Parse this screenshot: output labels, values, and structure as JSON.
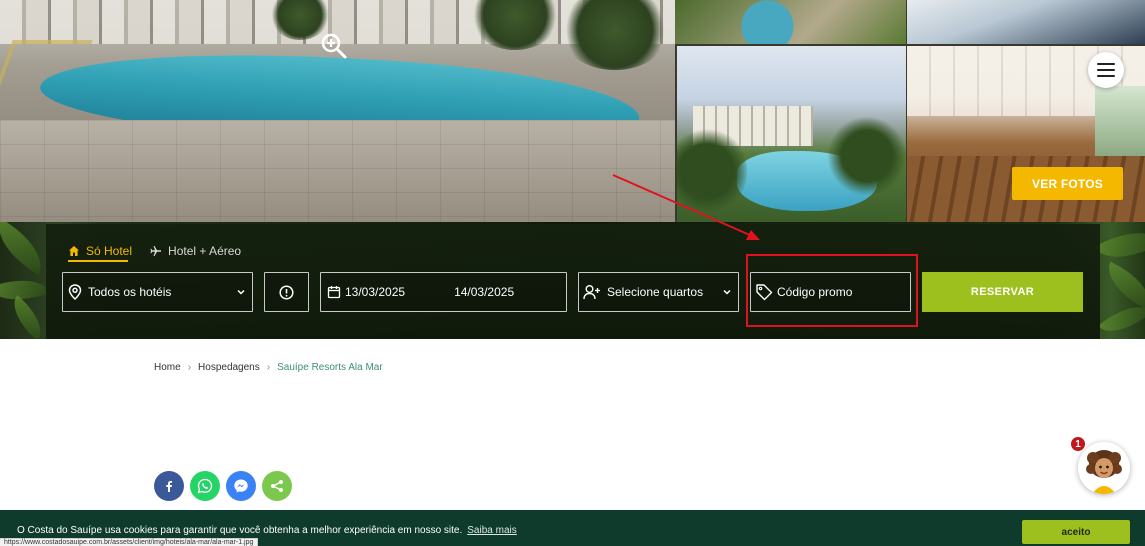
{
  "gallery": {
    "ver_fotos_label": "VER FOTOS"
  },
  "booking": {
    "tabs": [
      {
        "label": "Só Hotel",
        "icon": "home-icon",
        "active": true
      },
      {
        "label": "Hotel + Aéreo",
        "icon": "airplane-icon",
        "active": false
      }
    ],
    "hotel_select": "Todos os hotéis",
    "checkin": "13/03/2025",
    "checkout": "14/03/2025",
    "rooms_select": "Selecione quartos",
    "promo_placeholder": "Código promo",
    "reserve_label": "RESERVAR"
  },
  "breadcrumb": {
    "items": [
      "Home",
      "Hospedagens",
      "Sauípe Resorts Ala Mar"
    ]
  },
  "share": [
    {
      "icon": "facebook-icon",
      "color": "#3b5998"
    },
    {
      "icon": "whatsapp-icon",
      "color": "#25d366"
    },
    {
      "icon": "messenger-icon",
      "color": "#3b82f6"
    },
    {
      "icon": "share-icon",
      "color": "#7cc84f"
    }
  ],
  "chat": {
    "badge_count": "1"
  },
  "cookie": {
    "text": "O Costa do Sauípe usa cookies para garantir que você obtenha a melhor experiência em nosso site.",
    "link": "Saiba mais",
    "accept": "aceito"
  },
  "status_bar": {
    "url": "https://www.costadosauipe.com.br/assets/client/img/hoteis/ala-mar/ala-mar-1.jpg"
  },
  "colors": {
    "accent_yellow": "#f5b800",
    "accent_green": "#9dc01f",
    "dark_green": "#0e3b2c",
    "highlight_red": "#e0121e"
  }
}
